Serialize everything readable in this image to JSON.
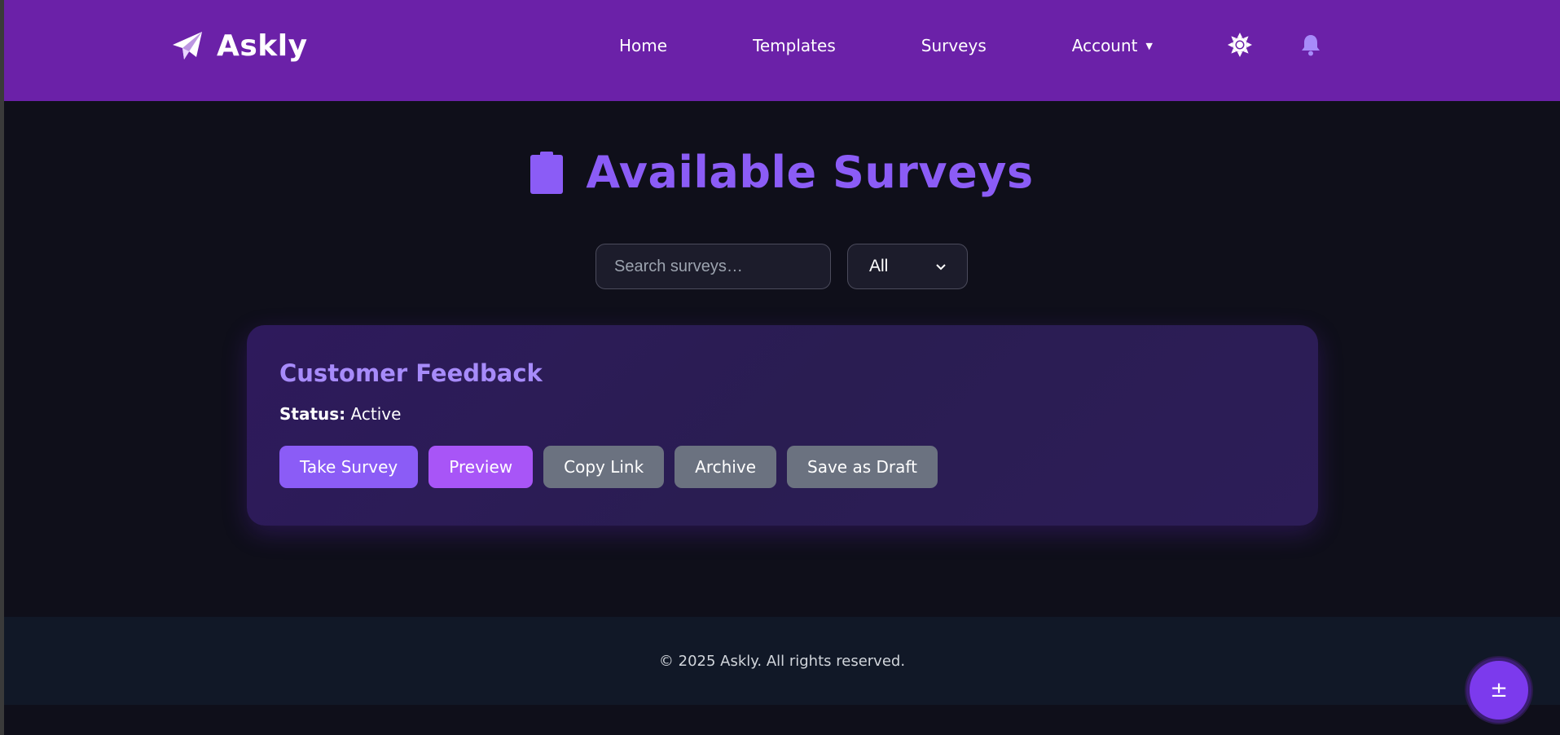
{
  "header": {
    "brand_name": "Askly",
    "brand_icon": "paper-plane-icon",
    "nav": {
      "home": "Home",
      "templates": "Templates",
      "surveys": "Surveys",
      "account": "Account",
      "account_caret": "▼"
    },
    "theme_icon": "sun-icon",
    "notifications_icon": "bell-icon",
    "background_color": "#6b21a8"
  },
  "main": {
    "title": "Available Surveys",
    "title_icon": "clipboard-icon",
    "title_color": "#8b5cf6",
    "search": {
      "placeholder": "Search surveys…",
      "value": ""
    },
    "filter": {
      "selected": "All",
      "chevron": "⌄"
    },
    "surveys": [
      {
        "title": "Customer Feedback",
        "status_label": "Status:",
        "status_value": "Active",
        "actions": {
          "take": "Take Survey",
          "preview": "Preview",
          "copy_link": "Copy Link",
          "archive": "Archive",
          "save_draft": "Save as Draft"
        }
      }
    ]
  },
  "footer": {
    "text": "© 2025 Askly. All rights reserved."
  },
  "fab": {
    "label": "±",
    "color": "#7c3aed"
  }
}
